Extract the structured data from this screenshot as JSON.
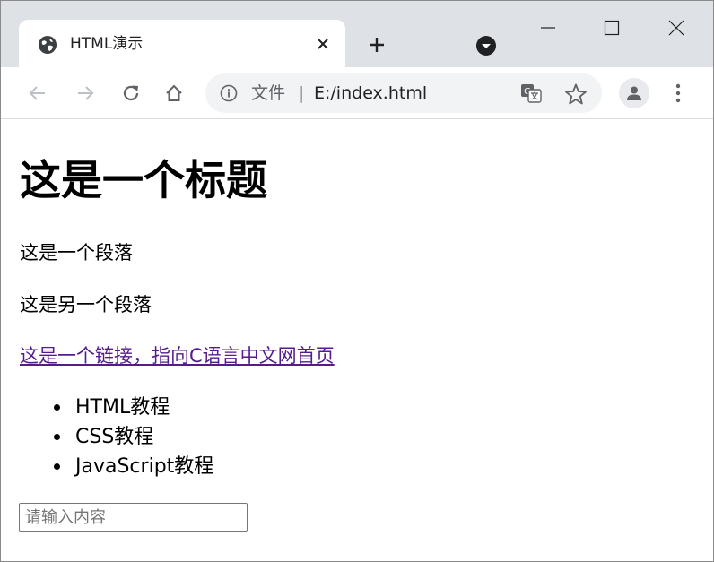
{
  "tab": {
    "title": "HTML演示",
    "favicon": "globe-icon",
    "close": "close-icon"
  },
  "toolbar": {
    "back": "arrow-left-icon",
    "forward": "arrow-right-icon",
    "reload": "reload-icon",
    "home": "home-icon"
  },
  "omnibox": {
    "scheme_label": "文件",
    "separator": "|",
    "url": "E:/index.html"
  },
  "page": {
    "heading": "这是一个标题",
    "paragraph1": "这是一个段落",
    "paragraph2": "这是另一个段落",
    "link_text": "这是一个链接，指向C语言中文网首页",
    "list_items": [
      "HTML教程",
      "CSS教程",
      "JavaScript教程"
    ],
    "input_placeholder": "请输入内容"
  },
  "colors": {
    "tabstrip_bg": "#dee1e6",
    "omnibox_bg": "#f1f3f4",
    "link_visited": "#551a8b",
    "icon_gray": "#5f6368"
  }
}
